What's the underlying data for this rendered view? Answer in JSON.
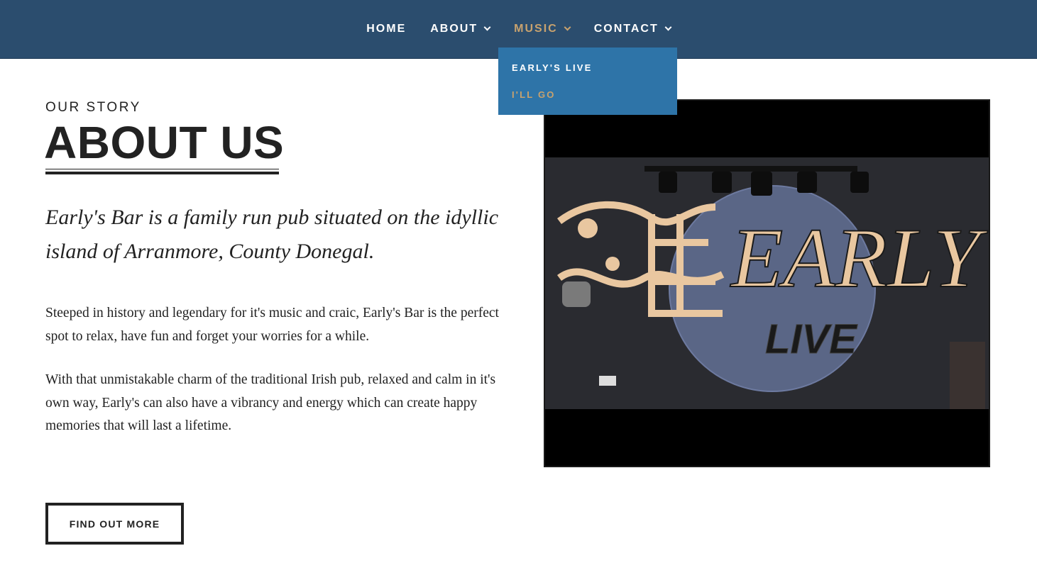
{
  "nav": {
    "items": [
      {
        "label": "HOME",
        "has_dropdown": false,
        "active": false
      },
      {
        "label": "ABOUT",
        "has_dropdown": true,
        "active": false
      },
      {
        "label": "MUSIC",
        "has_dropdown": true,
        "active": true
      },
      {
        "label": "CONTACT",
        "has_dropdown": true,
        "active": false
      }
    ],
    "dropdown": {
      "parent": "MUSIC",
      "items": [
        "EARLY'S LIVE",
        "I'LL GO"
      ]
    }
  },
  "about": {
    "kicker": "OUR STORY",
    "heading": "ABOUT US",
    "lead": "Early's Bar is a family run pub situated on the idyllic island of Arranmore, County Donegal.",
    "paragraphs": [
      "Steeped in history and legendary for it's music and craic, Early's Bar is the perfect spot to relax, have fun and forget your worries for a while.",
      "With that unmistakable charm of the traditional Irish pub, relaxed and calm in it's own way, Early's can also have a vibrancy and energy which can create happy memories that will last a lifetime."
    ],
    "button_label": "FIND OUT MORE"
  },
  "photo": {
    "sign_text": "EARLY'S",
    "sign_subtext": "LIVE"
  },
  "colors": {
    "nav_bg": "#2b4d6e",
    "dropdown_bg": "#2e74a8",
    "accent_gold": "#c8a26e",
    "text_dark": "#222222"
  }
}
